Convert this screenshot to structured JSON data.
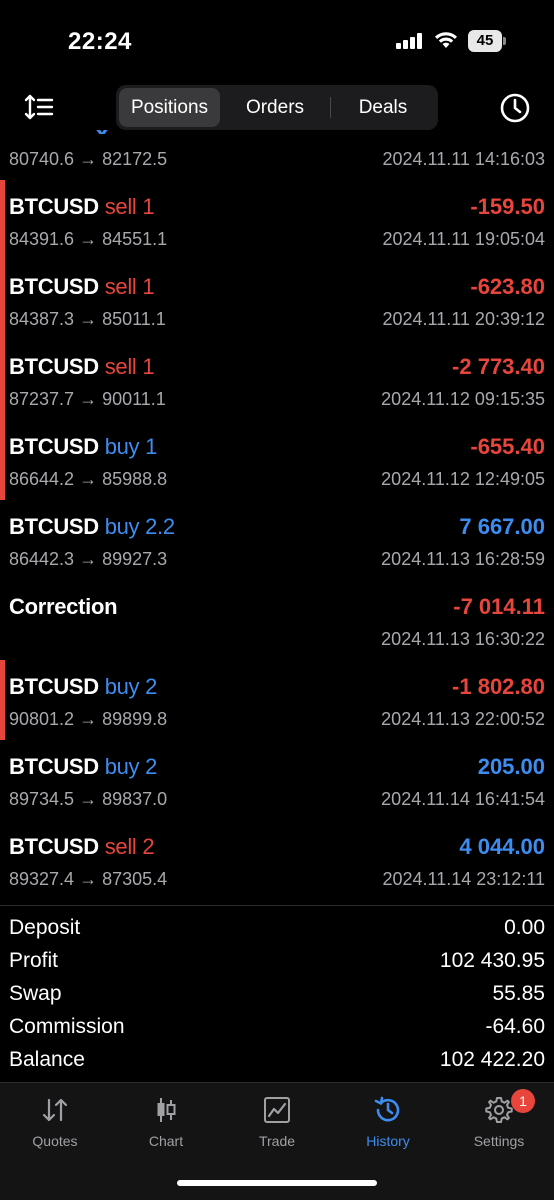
{
  "status_bar": {
    "time": "22:24",
    "battery": "45"
  },
  "nav": {
    "tabs": [
      {
        "label": "Positions"
      },
      {
        "label": "Orders"
      },
      {
        "label": "Deals"
      }
    ],
    "active_tab": "Positions"
  },
  "partial_row": {
    "prices": "80740.6 → 82172.5",
    "time": "2024.11.11 14:16:03"
  },
  "rows": [
    {
      "symbol": "BTCUSD",
      "side": "sell",
      "volume": "1",
      "profit": "-159.50",
      "prices": "84391.6 → 84551.1",
      "time": "2024.11.11 19:05:04"
    },
    {
      "symbol": "BTCUSD",
      "side": "sell",
      "volume": "1",
      "profit": "-623.80",
      "prices": "84387.3 → 85011.1",
      "time": "2024.11.11 20:39:12"
    },
    {
      "symbol": "BTCUSD",
      "side": "sell",
      "volume": "1",
      "profit": "-2 773.40",
      "prices": "87237.7 → 90011.1",
      "time": "2024.11.12 09:15:35"
    },
    {
      "symbol": "BTCUSD",
      "side": "buy",
      "volume": "1",
      "profit": "-655.40",
      "prices": "86644.2 → 85988.8",
      "time": "2024.11.12 12:49:05"
    },
    {
      "symbol": "BTCUSD",
      "side": "buy",
      "volume": "2.2",
      "profit": "7 667.00",
      "prices": "86442.3 → 89927.3",
      "time": "2024.11.13 16:28:59"
    },
    {
      "symbol": "Correction",
      "side": "",
      "volume": "",
      "profit": "-7 014.11",
      "prices": "",
      "time": "2024.11.13 16:30:22"
    },
    {
      "symbol": "BTCUSD",
      "side": "buy",
      "volume": "2",
      "profit": "-1 802.80",
      "prices": "90801.2 → 89899.8",
      "time": "2024.11.13 22:00:52"
    },
    {
      "symbol": "BTCUSD",
      "side": "buy",
      "volume": "2",
      "profit": "205.00",
      "prices": "89734.5 → 89837.0",
      "time": "2024.11.14 16:41:54"
    },
    {
      "symbol": "BTCUSD",
      "side": "sell",
      "volume": "2",
      "profit": "4 044.00",
      "prices": "89327.4 → 87305.4",
      "time": "2024.11.14 23:12:11"
    }
  ],
  "summary": [
    {
      "label": "Deposit",
      "value": "0.00"
    },
    {
      "label": "Profit",
      "value": "102 430.95"
    },
    {
      "label": "Swap",
      "value": "55.85"
    },
    {
      "label": "Commission",
      "value": "-64.60"
    },
    {
      "label": "Balance",
      "value": "102 422.20"
    }
  ],
  "tabbar": {
    "items": [
      {
        "label": "Quotes",
        "icon": "quotes-arrows-icon"
      },
      {
        "label": "Chart",
        "icon": "candlestick-icon"
      },
      {
        "label": "Trade",
        "icon": "trade-chart-icon"
      },
      {
        "label": "History",
        "icon": "history-clock-icon"
      },
      {
        "label": "Settings",
        "icon": "gear-icon"
      }
    ],
    "active": "History",
    "settings_badge": "1"
  },
  "colors": {
    "sell": "#e8453c",
    "buy": "#3d8df0",
    "loss": "#e8453c",
    "gain": "#3d8df0",
    "active": "#3d8df0"
  }
}
